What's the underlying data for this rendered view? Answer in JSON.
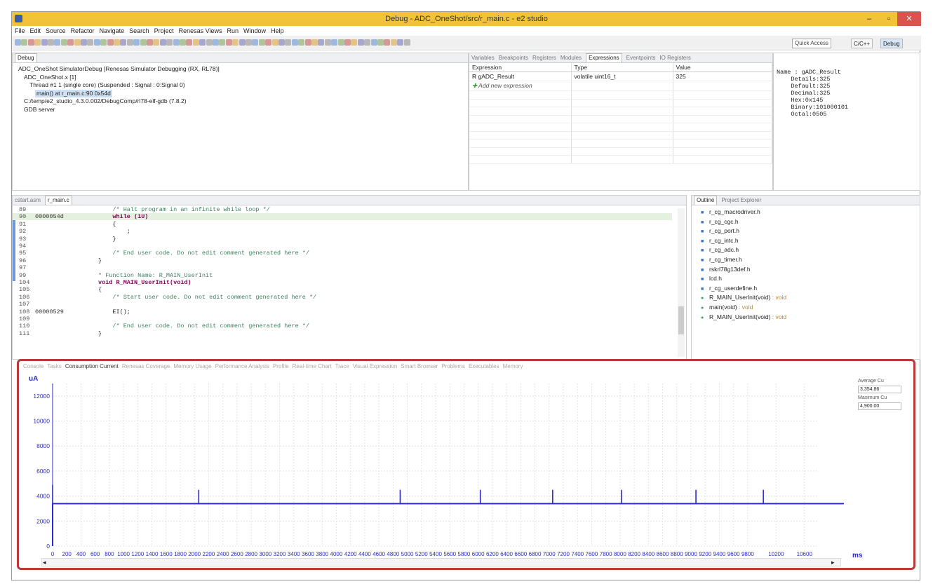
{
  "window": {
    "title": "Debug - ADC_OneShot/src/r_main.c - e2 studio",
    "min": "–",
    "max": "▫",
    "close": "✕"
  },
  "menu": [
    "File",
    "Edit",
    "Source",
    "Refactor",
    "Navigate",
    "Search",
    "Project",
    "Renesas Views",
    "Run",
    "Window",
    "Help"
  ],
  "toolbar": {
    "quick_access": "Quick Access",
    "persp_cc": "C/C++",
    "persp_debug": "Debug"
  },
  "debug_panel": {
    "tab": "Debug",
    "tree": [
      "ADC_OneShot SimulatorDebug [Renesas Simulator Debugging (RX, RL78)]",
      "ADC_OneShot.x [1]",
      "Thread #1 1 (single core) (Suspended : Signal : 0:Signal 0)",
      "main() at r_main.c:90 0x54d",
      "C:/temp/e2_studio_4.3.0.002/DebugComp/rl78-elf-gdb (7.8.2)",
      "GDB server"
    ]
  },
  "expr_panel": {
    "tabs": [
      "Variables",
      "Breakpoints",
      "Registers",
      "Modules",
      "Expressions",
      "Eventpoints",
      "IO Registers"
    ],
    "columns": [
      "Expression",
      "Type",
      "Value"
    ],
    "rows": [
      {
        "expr": "gADC_Result",
        "type": "volatile uint16_t",
        "value": "325"
      }
    ],
    "add": "Add new expression",
    "details": [
      "Name : gADC_Result",
      "    Details:325",
      "    Default:325",
      "    Decimal:325",
      "    Hex:0x145",
      "    Binary:101000101",
      "    Octal:0505"
    ]
  },
  "editor": {
    "tabs": [
      "cstart.asm",
      "r_main.c"
    ],
    "lines": [
      {
        "n": "89",
        "a": "",
        "s": "    /* Halt program in an infinite while loop */",
        "c": "cm"
      },
      {
        "n": "90",
        "a": "0000054d",
        "s": "    while (1U)",
        "c": "kw"
      },
      {
        "n": "91",
        "a": "",
        "s": "    {",
        "c": ""
      },
      {
        "n": "92",
        "a": "",
        "s": "        ;",
        "c": ""
      },
      {
        "n": "93",
        "a": "",
        "s": "    }",
        "c": ""
      },
      {
        "n": "94",
        "a": "",
        "s": "",
        "c": ""
      },
      {
        "n": "95",
        "a": "",
        "s": "    /* End user code. Do not edit comment generated here */",
        "c": "cm"
      },
      {
        "n": "96",
        "a": "",
        "s": "}",
        "c": ""
      },
      {
        "n": "97",
        "a": "",
        "s": "",
        "c": ""
      },
      {
        "n": "99",
        "a": "",
        "s": "* Function Name: R_MAIN_UserInit",
        "c": "cm"
      },
      {
        "n": "104",
        "a": "",
        "s": "void R_MAIN_UserInit(void)",
        "c": "kw"
      },
      {
        "n": "105",
        "a": "",
        "s": "{",
        "c": ""
      },
      {
        "n": "106",
        "a": "",
        "s": "    /* Start user code. Do not edit comment generated here */",
        "c": "cm"
      },
      {
        "n": "107",
        "a": "",
        "s": "",
        "c": ""
      },
      {
        "n": "108",
        "a": "00000529",
        "s": "    EI();",
        "c": ""
      },
      {
        "n": "109",
        "a": "",
        "s": "",
        "c": ""
      },
      {
        "n": "110",
        "a": "",
        "s": "    /* End user code. Do not edit comment generated here */",
        "c": "cm"
      },
      {
        "n": "111",
        "a": "",
        "s": "}",
        "c": ""
      }
    ]
  },
  "outline": {
    "tabs": [
      "Outline",
      "Project Explorer"
    ],
    "items": [
      {
        "icon": "h",
        "name": "r_cg_macrodriver.h",
        "type": ""
      },
      {
        "icon": "h",
        "name": "r_cg_cgc.h",
        "type": ""
      },
      {
        "icon": "h",
        "name": "r_cg_port.h",
        "type": ""
      },
      {
        "icon": "h",
        "name": "r_cg_intc.h",
        "type": ""
      },
      {
        "icon": "h",
        "name": "r_cg_adc.h",
        "type": ""
      },
      {
        "icon": "h",
        "name": "r_cg_timer.h",
        "type": ""
      },
      {
        "icon": "h",
        "name": "rskrl78g13def.h",
        "type": ""
      },
      {
        "icon": "h",
        "name": "lcd.h",
        "type": ""
      },
      {
        "icon": "h",
        "name": "r_cg_userdefine.h",
        "type": ""
      },
      {
        "icon": "f",
        "name": "R_MAIN_UserInit(void)",
        "type": " : void"
      },
      {
        "icon": "f",
        "name": "main(void)",
        "type": " : void"
      },
      {
        "icon": "f",
        "name": "R_MAIN_UserInit(void)",
        "type": " : void"
      }
    ]
  },
  "bottom": {
    "tabs": [
      "Console",
      "Tasks",
      "Consumption Current",
      "Renesas Coverage",
      "Memory Usage",
      "Performance Analysis",
      "Profile",
      "Real-time Chart",
      "Trace",
      "Visual Expression",
      "Smart Browser",
      "Problems",
      "Executables",
      "Memory"
    ],
    "active_tab": "Consumption Current",
    "avg_label": "Average Cu",
    "avg_value": "3,354.86",
    "max_label": "Maximum Cu",
    "max_value": "4,900.00"
  },
  "chart_data": {
    "type": "line",
    "ylabel": "uA",
    "xlabel": "ms",
    "ylim": [
      0,
      13000
    ],
    "xlim": [
      0,
      10800
    ],
    "yticks": [
      0,
      2000,
      4000,
      6000,
      8000,
      10000,
      12000
    ],
    "xticks": [
      0,
      200,
      400,
      600,
      800,
      1000,
      1200,
      1400,
      1600,
      1800,
      2000,
      2200,
      2400,
      2600,
      2800,
      3000,
      3200,
      3400,
      3600,
      3800,
      4000,
      4200,
      4400,
      4600,
      4800,
      5000,
      5200,
      5400,
      5600,
      5800,
      6000,
      6200,
      6400,
      6600,
      6800,
      7000,
      7200,
      7400,
      7600,
      7800,
      8000,
      8200,
      8400,
      8600,
      8800,
      9000,
      9200,
      9400,
      9600,
      9800,
      10200,
      10600
    ],
    "baseline": 3400,
    "spikes": [
      {
        "x": 0,
        "y": 4900
      },
      {
        "x": 2060,
        "y": 4500
      },
      {
        "x": 4900,
        "y": 4500
      },
      {
        "x": 6030,
        "y": 4500
      },
      {
        "x": 7050,
        "y": 4500
      },
      {
        "x": 8020,
        "y": 4500
      },
      {
        "x": 9070,
        "y": 4500
      },
      {
        "x": 10020,
        "y": 4500
      }
    ],
    "color": "#2a2acc"
  }
}
